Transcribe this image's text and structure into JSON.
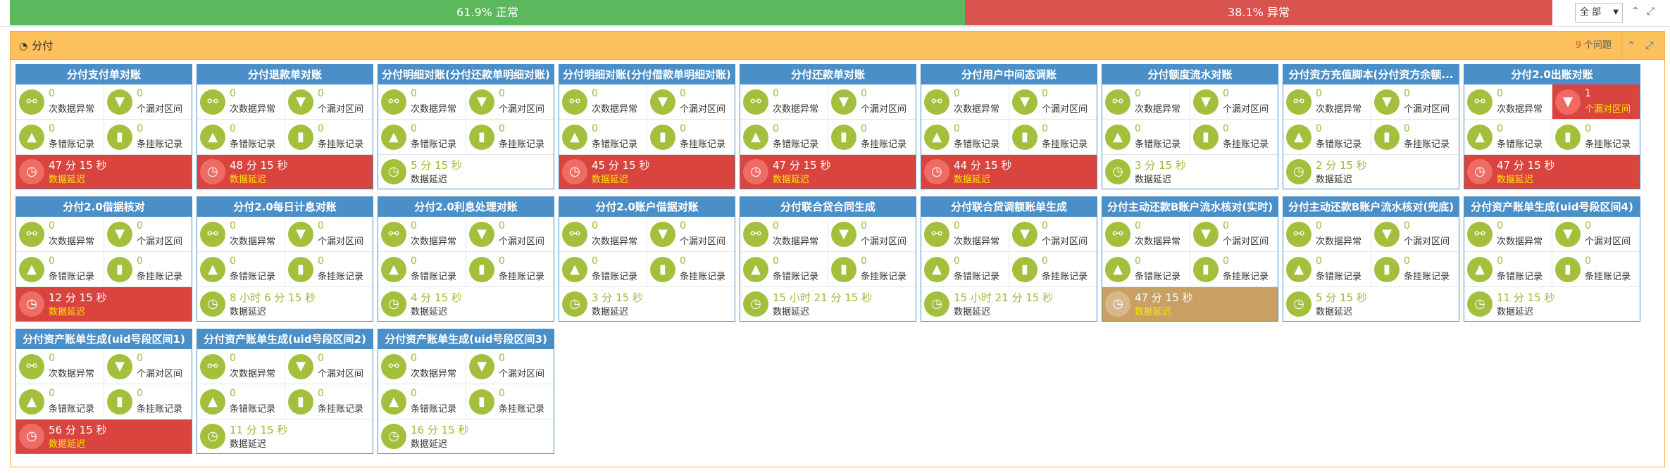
{
  "status_bar": {
    "ok_label": "61.9% 正常",
    "ok_fraction": 0.619,
    "bad_label": "38.1% 异常",
    "bad_fraction": 0.381,
    "scope_select": "全  部",
    "colors": {
      "ok": "#5cb85c",
      "bad": "#d9534f"
    }
  },
  "panel": {
    "title": "分付",
    "issues_count": "9",
    "issues_label": " 个问题",
    "icons": {
      "title": "dashboard-icon",
      "collapse": "chevron-up-icon",
      "expand": "expand-icon"
    }
  },
  "labels": {
    "data_anomaly": "次数据异常",
    "missing_interval": "个漏对区间",
    "error_records": "条错账记录",
    "pending_records": "条挂账记录",
    "data_delay": "数据延迟"
  },
  "cards": [
    {
      "title": "分付支付单对账",
      "anomaly": "0",
      "missing": "0",
      "missing_alert": false,
      "errors": "0",
      "pending": "0",
      "delay": "47 分 15 秒",
      "delay_state": "red"
    },
    {
      "title": "分付退款单对账",
      "anomaly": "0",
      "missing": "0",
      "missing_alert": false,
      "errors": "0",
      "pending": "0",
      "delay": "48 分 15 秒",
      "delay_state": "red"
    },
    {
      "title": "分付明细对账(分付还款单明细对账)",
      "anomaly": "0",
      "missing": "0",
      "missing_alert": false,
      "errors": "0",
      "pending": "0",
      "delay": "5 分 15 秒",
      "delay_state": "ok"
    },
    {
      "title": "分付明细对账(分付借款单明细对账)",
      "anomaly": "0",
      "missing": "0",
      "missing_alert": false,
      "errors": "0",
      "pending": "0",
      "delay": "45 分 15 秒",
      "delay_state": "red"
    },
    {
      "title": "分付还款单对账",
      "anomaly": "0",
      "missing": "0",
      "missing_alert": false,
      "errors": "0",
      "pending": "0",
      "delay": "47 分 15 秒",
      "delay_state": "red"
    },
    {
      "title": "分付用户中间态调账",
      "anomaly": "0",
      "missing": "0",
      "missing_alert": false,
      "errors": "0",
      "pending": "0",
      "delay": "44 分 15 秒",
      "delay_state": "red"
    },
    {
      "title": "分付额度流水对账",
      "anomaly": "0",
      "missing": "0",
      "missing_alert": false,
      "errors": "0",
      "pending": "0",
      "delay": "3 分 15 秒",
      "delay_state": "ok"
    },
    {
      "title": "分付资方充值脚本(分付资方余额...",
      "anomaly": "0",
      "missing": "0",
      "missing_alert": false,
      "errors": "0",
      "pending": "0",
      "delay": "2 分 15 秒",
      "delay_state": "ok"
    },
    {
      "title": "分付2.0出账对账",
      "anomaly": "0",
      "missing": "1",
      "missing_alert": true,
      "errors": "0",
      "pending": "0",
      "delay": "47 分 15 秒",
      "delay_state": "red"
    },
    {
      "title": "分付2.0借据核对",
      "anomaly": "0",
      "missing": "0",
      "missing_alert": false,
      "errors": "0",
      "pending": "0",
      "delay": "12 分 15 秒",
      "delay_state": "red"
    },
    {
      "title": "分付2.0每日计息对账",
      "anomaly": "0",
      "missing": "0",
      "missing_alert": false,
      "errors": "0",
      "pending": "0",
      "delay": "8 小时 6 分 15 秒",
      "delay_state": "ok"
    },
    {
      "title": "分付2.0利息处理对账",
      "anomaly": "0",
      "missing": "0",
      "missing_alert": false,
      "errors": "0",
      "pending": "0",
      "delay": "4 分 15 秒",
      "delay_state": "ok"
    },
    {
      "title": "分付2.0账户借据对账",
      "anomaly": "0",
      "missing": "0",
      "missing_alert": false,
      "errors": "0",
      "pending": "0",
      "delay": "3 分 15 秒",
      "delay_state": "ok"
    },
    {
      "title": "分付联合贷合同生成",
      "anomaly": "0",
      "missing": "0",
      "missing_alert": false,
      "errors": "0",
      "pending": "0",
      "delay": "15 小时 21 分 15 秒",
      "delay_state": "ok"
    },
    {
      "title": "分付联合贷调额账单生成",
      "anomaly": "0",
      "missing": "0",
      "missing_alert": false,
      "errors": "0",
      "pending": "0",
      "delay": "15 小时 21 分 15 秒",
      "delay_state": "ok"
    },
    {
      "title": "分付主动还款B账户流水核对(实时)",
      "anomaly": "0",
      "missing": "0",
      "missing_alert": false,
      "errors": "0",
      "pending": "0",
      "delay": "47 分 15 秒",
      "delay_state": "tan"
    },
    {
      "title": "分付主动还款B账户流水核对(兜底)",
      "anomaly": "0",
      "missing": "0",
      "missing_alert": false,
      "errors": "0",
      "pending": "0",
      "delay": "5 分 15 秒",
      "delay_state": "ok"
    },
    {
      "title": "分付资产账单生成(uid号段区间4)",
      "anomaly": "0",
      "missing": "0",
      "missing_alert": false,
      "errors": "0",
      "pending": "0",
      "delay": "11 分 15 秒",
      "delay_state": "ok"
    },
    {
      "title": "分付资产账单生成(uid号段区间1)",
      "anomaly": "0",
      "missing": "0",
      "missing_alert": false,
      "errors": "0",
      "pending": "0",
      "delay": "56 分 15 秒",
      "delay_state": "red"
    },
    {
      "title": "分付资产账单生成(uid号段区间2)",
      "anomaly": "0",
      "missing": "0",
      "missing_alert": false,
      "errors": "0",
      "pending": "0",
      "delay": "11 分 15 秒",
      "delay_state": "ok"
    },
    {
      "title": "分付资产账单生成(uid号段区间3)",
      "anomaly": "0",
      "missing": "0",
      "missing_alert": false,
      "errors": "0",
      "pending": "0",
      "delay": "16 分 15 秒",
      "delay_state": "ok"
    }
  ],
  "icons": {
    "anomaly": "unlink-icon",
    "missing": "filter-icon",
    "errors": "warning-icon",
    "pending": "bookmark-icon",
    "delay": "clock-icon"
  }
}
